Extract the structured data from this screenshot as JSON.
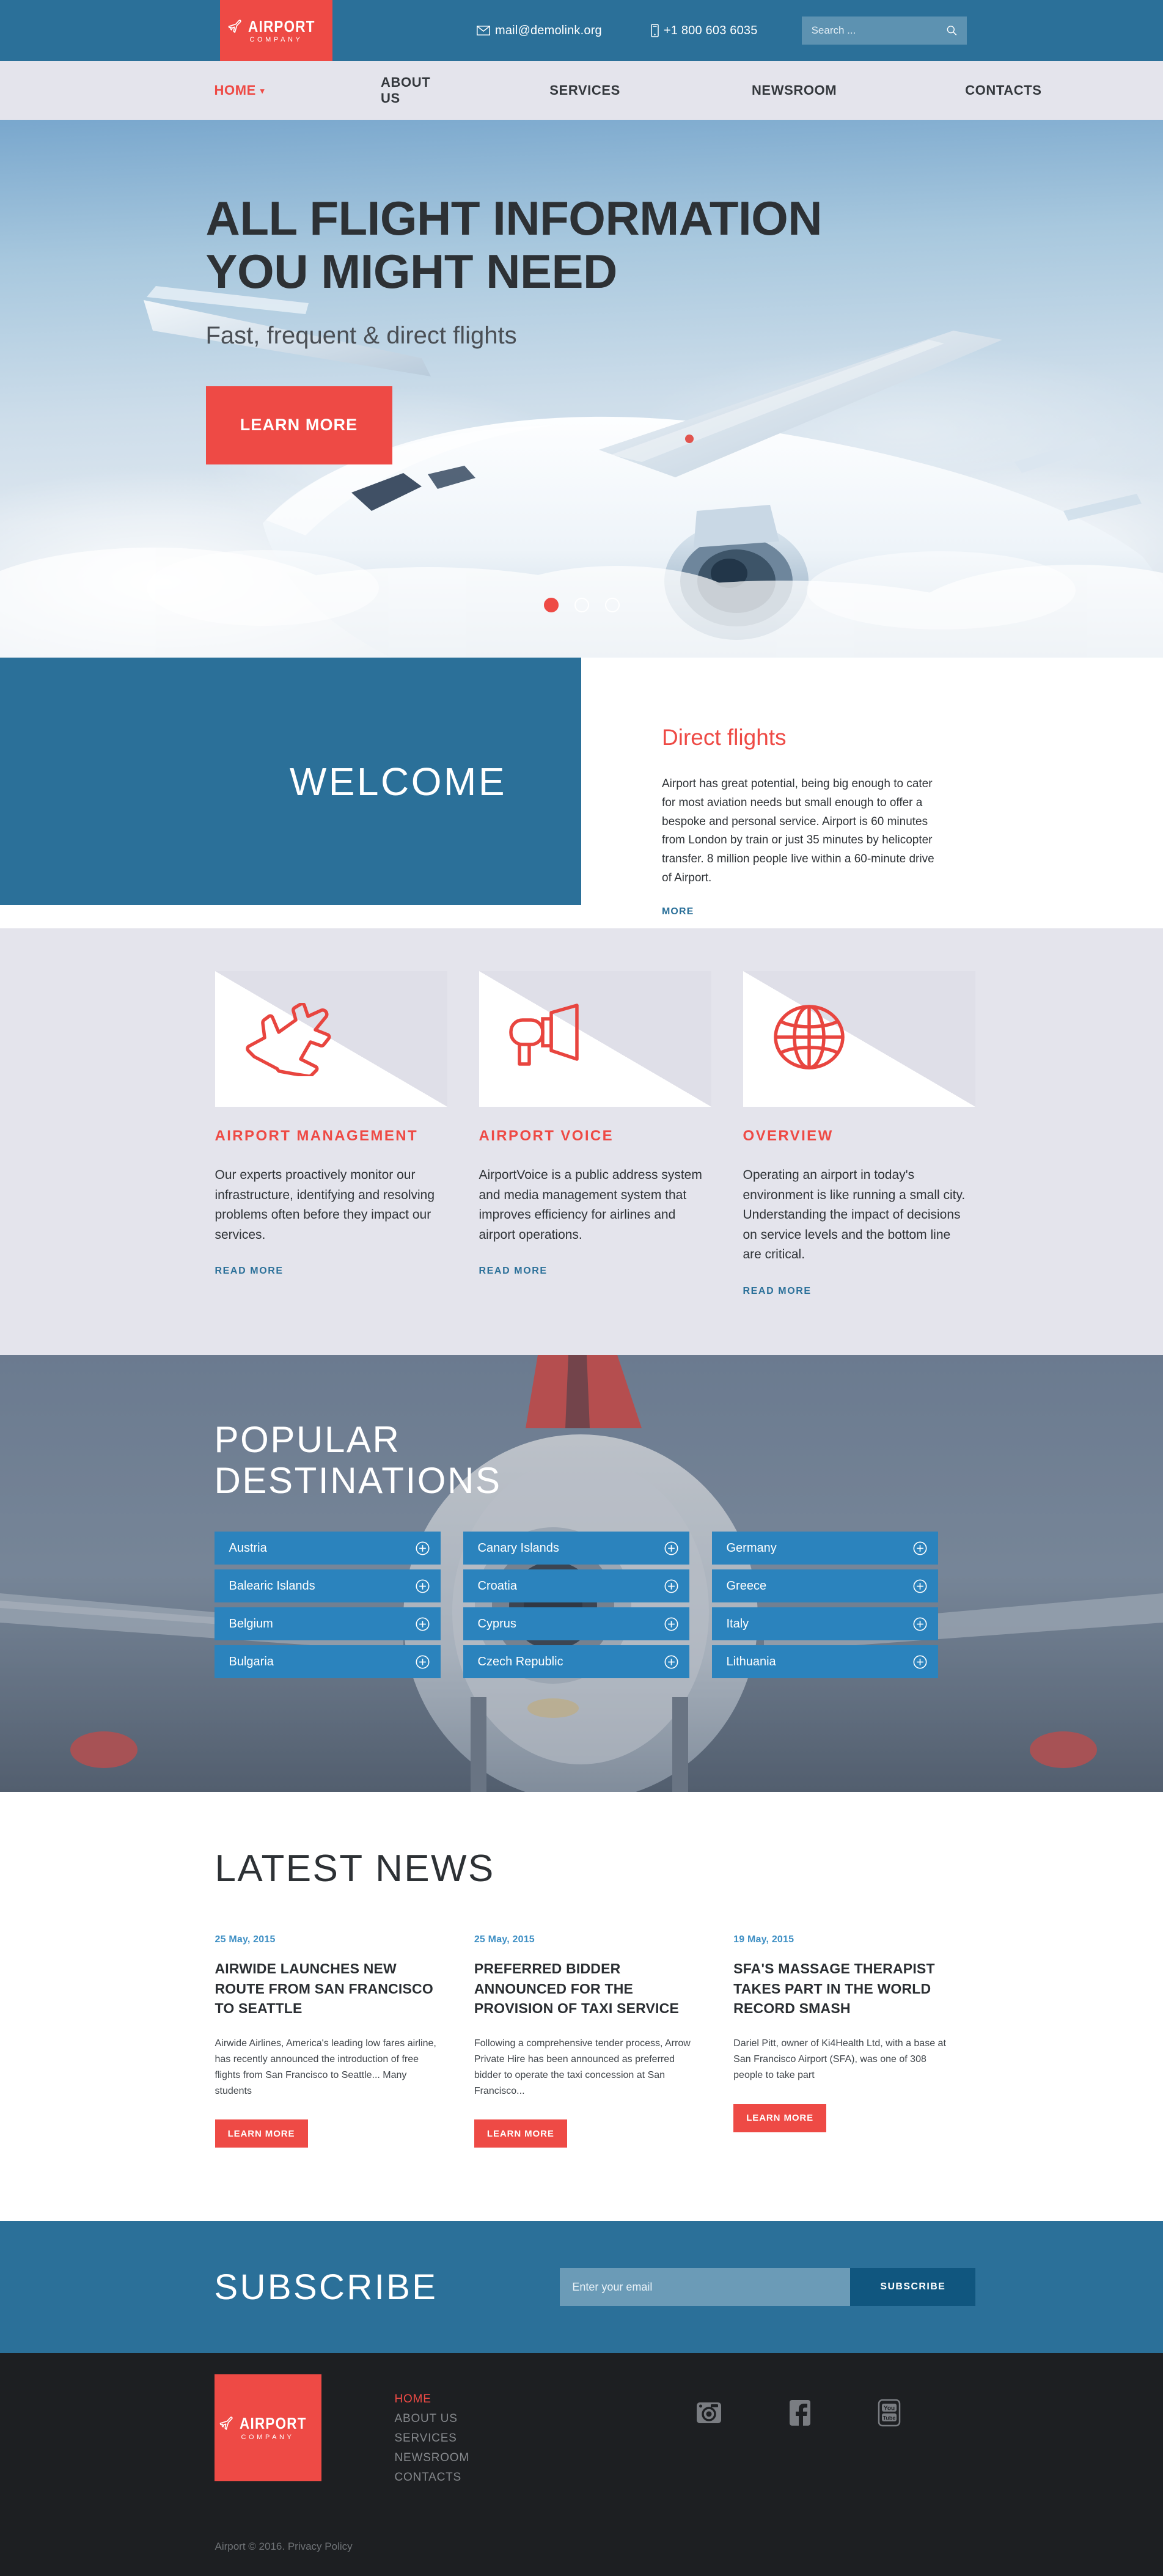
{
  "brand": {
    "name": "AIRPORT",
    "tagline": "COMPANY",
    "accent_red": "#ee4a45",
    "accent_blue": "#2b7099",
    "nav_bg": "#e4e4ec"
  },
  "topbar": {
    "email": "mail@demolink.org",
    "email_icon": "envelope-icon",
    "phone": "+1 800 603 6035",
    "phone_icon": "mobile-phone-icon",
    "search_placeholder": "Search ...",
    "search_value": "",
    "search_icon": "search-icon"
  },
  "nav": {
    "items": [
      {
        "label": "HOME",
        "active": true,
        "has_dropdown": true
      },
      {
        "label": "ABOUT US",
        "active": false,
        "has_dropdown": false
      },
      {
        "label": "SERVICES",
        "active": false,
        "has_dropdown": false
      },
      {
        "label": "NEWSROOM",
        "active": false,
        "has_dropdown": false
      },
      {
        "label": "CONTACTS",
        "active": false,
        "has_dropdown": false
      }
    ]
  },
  "hero": {
    "heading_line1": "ALL FLIGHT INFORMATION",
    "heading_line2": "YOU MIGHT NEED",
    "subtitle": "Fast, frequent & direct flights",
    "cta": "LEARN MORE",
    "slider": {
      "total": 3,
      "active_index": 0
    }
  },
  "welcome": {
    "heading": "WELCOME",
    "card_title": "Direct flights",
    "card_text": "Airport has great potential, being big enough to cater for most aviation needs but small enough to offer a bespoke and personal service. Airport is 60 minutes from London by train or just 35 minutes by helicopter transfer. 8 million people live within a 60-minute drive of Airport.",
    "card_link": "MORE"
  },
  "services": {
    "cards": [
      {
        "icon": "airplane-icon",
        "title": "AIRPORT MANAGEMENT",
        "text": "Our experts proactively monitor our infrastructure, identifying and resolving problems often before they impact our services.",
        "link": "READ MORE"
      },
      {
        "icon": "megaphone-icon",
        "title": "AIRPORT VOICE",
        "text": "AirportVoice is a public address system and media management system that improves efficiency for airlines and airport operations.",
        "link": "READ MORE"
      },
      {
        "icon": "globe-icon",
        "title": "OVERVIEW",
        "text": "Operating an airport in today's environment is like running a small city. Understanding the impact of decisions on service levels and the bottom line are critical.",
        "link": "READ MORE"
      }
    ]
  },
  "destinations": {
    "heading_line1": "POPULAR",
    "heading_line2": "DESTINATIONS",
    "item_icon": "plus-circle-icon",
    "columns": [
      [
        "Austria",
        "Balearic Islands",
        "Belgium",
        "Bulgaria"
      ],
      [
        "Canary Islands",
        "Croatia",
        "Cyprus",
        "Czech Republic"
      ],
      [
        "Germany",
        "Greece",
        "Italy",
        "Lithuania"
      ]
    ]
  },
  "news": {
    "heading": "LATEST NEWS",
    "items": [
      {
        "date": "25 May, 2015",
        "title": "AIRWIDE LAUNCHES NEW ROUTE FROM SAN FRANCISCO TO SEATTLE",
        "text": "Airwide Airlines, America's leading low fares airline, has recently announced the introduction of free flights from San Francisco to Seattle... Many students",
        "cta": "LEARN MORE"
      },
      {
        "date": "25 May, 2015",
        "title": "PREFERRED BIDDER ANNOUNCED FOR THE PROVISION OF TAXI SERVICE",
        "text": "Following a comprehensive tender process, Arrow Private Hire has been announced as preferred bidder to operate the taxi concession at San Francisco...",
        "cta": "LEARN MORE"
      },
      {
        "date": "19 May, 2015",
        "title": "SFA'S MASSAGE THERAPIST TAKES PART IN THE WORLD RECORD SMASH",
        "text": "Dariel Pitt, owner of Ki4Health Ltd, with a base at San Francisco Airport (SFA), was one of 308 people to take part",
        "cta": "LEARN MORE"
      }
    ]
  },
  "subscribe": {
    "heading": "SUBSCRIBE",
    "placeholder": "Enter your email",
    "value": "",
    "button": "SUBSCRIBE"
  },
  "footer": {
    "nav": [
      {
        "label": "HOME",
        "active": true
      },
      {
        "label": "ABOUT US",
        "active": false
      },
      {
        "label": "SERVICES",
        "active": false
      },
      {
        "label": "NEWSROOM",
        "active": false
      },
      {
        "label": "CONTACTS",
        "active": false
      }
    ],
    "socials": [
      {
        "icon": "instagram-icon",
        "label": "Instagram"
      },
      {
        "icon": "facebook-icon",
        "label": "Facebook"
      },
      {
        "icon": "youtube-icon",
        "label": "YouTube"
      }
    ],
    "copyright": "Airport © 2016.",
    "privacy": "Privacy Policy"
  }
}
